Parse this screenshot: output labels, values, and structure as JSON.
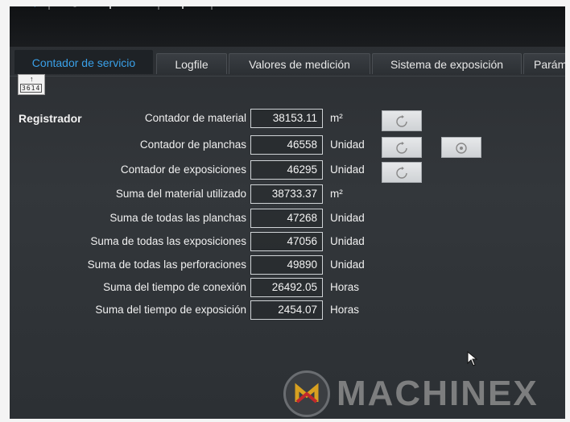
{
  "tabs": [
    {
      "label": "Contador de servicio",
      "active": true
    },
    {
      "label": "Logfile",
      "active": false
    },
    {
      "label": "Valores de medición",
      "active": false
    },
    {
      "label": "Sistema de exposición",
      "active": false
    },
    {
      "label": "Parám",
      "active": false
    }
  ],
  "counter_icon": {
    "digits": "3614",
    "icon": "counter-icon"
  },
  "section": {
    "label": "Registrador"
  },
  "rows": [
    {
      "label": "Contador de material",
      "value": "38153.11",
      "unit": "m²"
    },
    {
      "label": "Contador de planchas",
      "value": "46558",
      "unit": "Unidad"
    },
    {
      "label": "Contador de exposiciones",
      "value": "46295",
      "unit": "Unidad"
    },
    {
      "label": "Suma del material utilizado",
      "value": "38733.37",
      "unit": "m²"
    },
    {
      "label": "Suma de todas las planchas",
      "value": "47268",
      "unit": "Unidad"
    },
    {
      "label": "Suma de todas las exposiciones",
      "value": "47056",
      "unit": "Unidad"
    },
    {
      "label": "Suma de todas las perforaciones",
      "value": "49890",
      "unit": "Unidad"
    },
    {
      "label": "Suma del tiempo de conexión",
      "value": "26492.05",
      "unit": "Horas"
    },
    {
      "label": "Suma del tiempo de exposición",
      "value": "2454.07",
      "unit": "Horas"
    }
  ],
  "watermark": {
    "text": "MACHINEX"
  },
  "colors": {
    "accent": "#3aa0e8",
    "background": "#2f3337"
  }
}
